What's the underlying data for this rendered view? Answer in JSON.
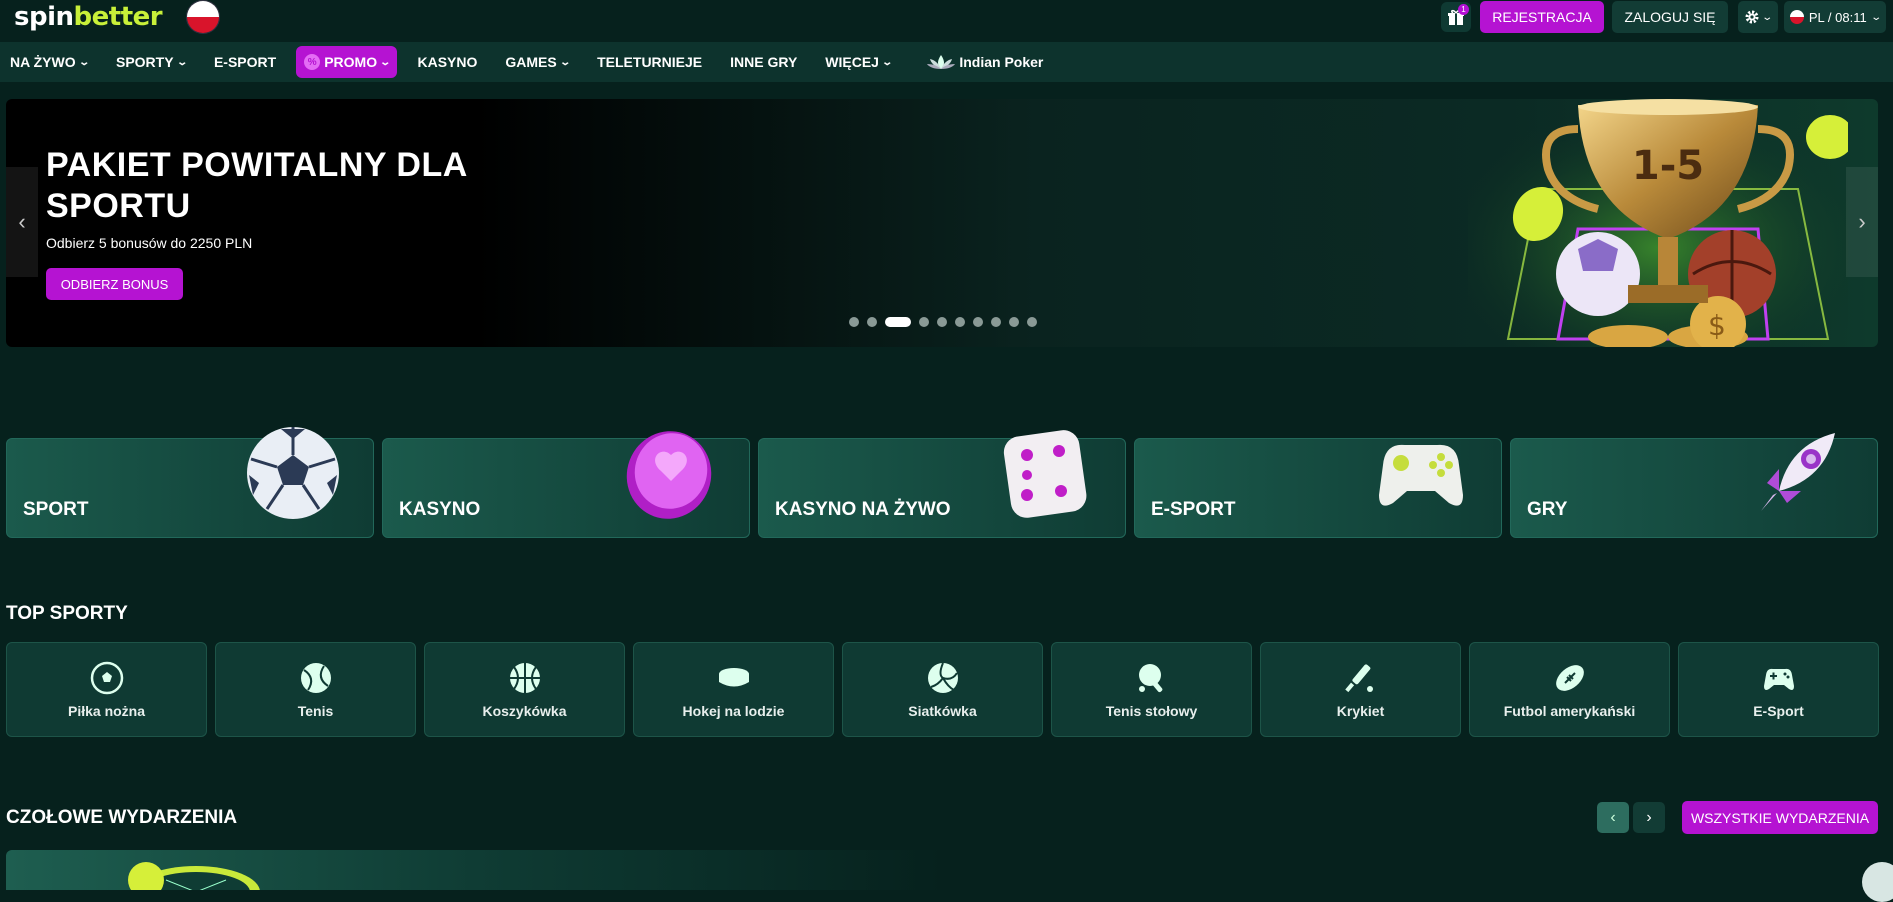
{
  "header": {
    "logo": {
      "part1": "spin",
      "part2": "better"
    },
    "gift_count": "1",
    "register_label": "REJESTRACJA",
    "login_label": "ZALOGUJ SIĘ",
    "lang_time": "PL / 08:11"
  },
  "nav": {
    "items": [
      {
        "label": "NA ŻYWO",
        "dropdown": true
      },
      {
        "label": "SPORTY",
        "dropdown": true
      },
      {
        "label": "E-SPORT",
        "dropdown": false
      },
      {
        "label": "PROMO",
        "dropdown": true
      },
      {
        "label": "KASYNO",
        "dropdown": false
      },
      {
        "label": "GAMES",
        "dropdown": true
      },
      {
        "label": "TELETURNIEJE",
        "dropdown": false
      },
      {
        "label": "INNE GRY",
        "dropdown": false
      },
      {
        "label": "WIĘCEJ",
        "dropdown": true
      },
      {
        "label": "Indian Poker",
        "dropdown": false
      }
    ]
  },
  "banner": {
    "title": "PAKIET POWITALNY DLA SPORTU",
    "subtitle": "Odbierz 5 bonusów do 2250 PLN",
    "button": "ODBIERZ BONUS",
    "trophy_text": "1-5",
    "slide_count": 11,
    "active_slide": 3
  },
  "categories": [
    {
      "label": "SPORT",
      "icon": "soccer-ball-icon"
    },
    {
      "label": "KASYNO",
      "icon": "casino-chip-icon"
    },
    {
      "label": "KASYNO NA ŻYWO",
      "icon": "dice-icon"
    },
    {
      "label": "E-SPORT",
      "icon": "gamepad-icon"
    },
    {
      "label": "GRY",
      "icon": "rocket-icon"
    }
  ],
  "top_sports": {
    "title": "TOP SPORTY",
    "items": [
      {
        "label": "Piłka nożna",
        "icon": "football-icon"
      },
      {
        "label": "Tenis",
        "icon": "tennis-icon"
      },
      {
        "label": "Koszykówka",
        "icon": "basketball-icon"
      },
      {
        "label": "Hokej na lodzie",
        "icon": "hockey-puck-icon"
      },
      {
        "label": "Siatkówka",
        "icon": "volleyball-icon"
      },
      {
        "label": "Tenis stołowy",
        "icon": "table-tennis-icon"
      },
      {
        "label": "Krykiet",
        "icon": "cricket-icon"
      },
      {
        "label": "Futbol amerykański",
        "icon": "american-football-icon"
      },
      {
        "label": "E-Sport",
        "icon": "gamepad-icon"
      }
    ]
  },
  "events": {
    "title": "CZOŁOWE WYDARZENIA",
    "all_label": "WSZYSTKIE WYDARZENIA"
  },
  "colors": {
    "accent": "#b513d2",
    "background": "#06211d",
    "logo_green": "#c8f039"
  }
}
